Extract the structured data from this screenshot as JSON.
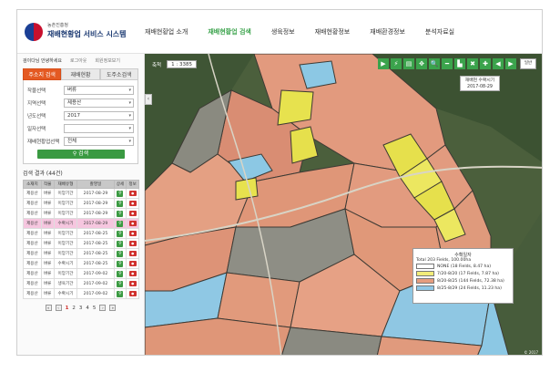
{
  "header": {
    "org": "농촌진흥청",
    "app_title": "재배현황업 서비스 시스템",
    "nav": [
      "재배현황업 소개",
      "재배현황업 검색",
      "생육정보",
      "재배현황정보",
      "재배환경정보",
      "분석자료실"
    ],
    "active_nav_index": 1
  },
  "sidebar": {
    "util_links": [
      "검이다님 안녕하세요",
      "로그아웃",
      "회원정보보기"
    ],
    "tabs": [
      "주소지 검색",
      "재배현황",
      "도주소검색"
    ],
    "active_tab_index": 0,
    "form": [
      {
        "label": "작물선택",
        "value": "벼류"
      },
      {
        "label": "지역선택",
        "value": "제용산"
      },
      {
        "label": "년도선택",
        "value": "2017"
      },
      {
        "label": "일자선택",
        "value": ""
      },
      {
        "label": "재배현황업선택",
        "value": "전체"
      }
    ],
    "search_button": "검색",
    "results_title": "검색 결과 (44건)",
    "table": {
      "headers": [
        "소재지",
        "작물",
        "재배유형",
        "촬영일",
        "상세",
        "정보"
      ],
      "rows": [
        [
          "제용산",
          "벼류",
          "이앙기간",
          "2017-08-29"
        ],
        [
          "제용산",
          "벼류",
          "이앙기간",
          "2017-08-29"
        ],
        [
          "제용산",
          "벼류",
          "이앙기간",
          "2017-08-29"
        ],
        [
          "제용산",
          "벼류",
          "수확시기",
          "2017-08-29"
        ],
        [
          "제용산",
          "벼류",
          "이앙기간",
          "2017-08-25"
        ],
        [
          "제용산",
          "벼류",
          "이앙기간",
          "2017-08-25"
        ],
        [
          "제용산",
          "벼류",
          "이앙기간",
          "2017-08-25"
        ],
        [
          "제용산",
          "벼류",
          "수확시기",
          "2017-08-25"
        ],
        [
          "제용산",
          "벼류",
          "이앙기간",
          "2017-09-02"
        ],
        [
          "제용산",
          "벼류",
          "생육기간",
          "2017-09-02"
        ],
        [
          "제용산",
          "벼류",
          "수확시기",
          "2017-09-02"
        ]
      ],
      "highlighted_row_index": 3,
      "detail_icon": "magnifier-icon",
      "info_icon": "info-badge-icon"
    },
    "pager": {
      "pages": [
        "1",
        "2",
        "3",
        "4",
        "5"
      ],
      "current": "1"
    }
  },
  "map": {
    "zoom_label": "축척",
    "zoom_value": "1 : 3385",
    "tools": [
      "▶",
      "⚡",
      "▤",
      "✥",
      "🔍",
      "━",
      "▙",
      "✖",
      "✚",
      "◀",
      "▶"
    ],
    "tool_icons": [
      "pointer-icon",
      "lightning-icon",
      "layer-icon",
      "pan-icon",
      "zoom-icon",
      "measure-line-icon",
      "measure-area-icon",
      "clear-icon",
      "add-icon",
      "prev-icon",
      "next-icon"
    ],
    "basemap_buttons": [
      "일반",
      "항공"
    ],
    "date_tag": {
      "line1": "재배현 수확시기",
      "line2": "2017-08-29"
    },
    "collapse_symbol": "‹",
    "legend": {
      "title": "수확일자",
      "summary": "Total 203 Fields, 100.00ha",
      "items": [
        {
          "label": "NONE (18 Fields, 8.47 ha)",
          "color": "#ffffff"
        },
        {
          "label": "7/20-8/20 (17 Fields, 7.87 ha)",
          "color": "#f2ec7a"
        },
        {
          "label": "8/20-8/25 (144 Fields, 72.38 ha)",
          "color": "#e59d7f"
        },
        {
          "label": "8/25-8/29 (24 Fields, 11.23 ha)",
          "color": "#8fc7e6"
        }
      ]
    },
    "scale_text": "© 2017",
    "colors": {
      "yellow": "#e6e24d",
      "salmon": "#e59a7d",
      "blue": "#8cc8e4",
      "gray": "#8f8f86",
      "forest": "#4f6a3f"
    }
  }
}
